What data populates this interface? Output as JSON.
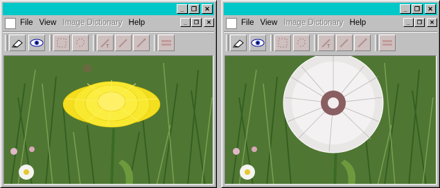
{
  "windows": [
    {
      "id": "left",
      "menu": {
        "file": "File",
        "view": "View",
        "image_dictionary": "Image Dictionary",
        "help": "Help"
      },
      "title_buttons": [
        "_",
        "❐",
        "✕"
      ],
      "menu_buttons": [
        "_",
        "❐",
        "✕"
      ],
      "toolbar_icons": [
        "eraser-icon",
        "eye-icon",
        "rect-select-icon",
        "lasso-select-icon",
        "text-tool-icon",
        "line-tool-icon",
        "pen-tool-icon",
        "stamp-icon"
      ],
      "image_subject": "dandelion-flower"
    },
    {
      "id": "right",
      "menu": {
        "file": "File",
        "view": "View",
        "image_dictionary": "Image Dictionary",
        "help": "Help"
      },
      "title_buttons": [
        "_",
        "❐",
        "✕"
      ],
      "menu_buttons": [
        "_",
        "❐",
        "✕"
      ],
      "toolbar_icons": [
        "eraser-icon",
        "eye-icon",
        "rect-select-icon",
        "lasso-select-icon",
        "text-tool-icon",
        "line-tool-icon",
        "pen-tool-icon",
        "stamp-icon"
      ],
      "image_subject": "dandelion-seedhead"
    }
  ],
  "colors": {
    "titlebar": "#00c8c8",
    "chrome": "#c0c0c0",
    "flower": "#ffe82a",
    "seedhead": "#f4f2f2"
  }
}
